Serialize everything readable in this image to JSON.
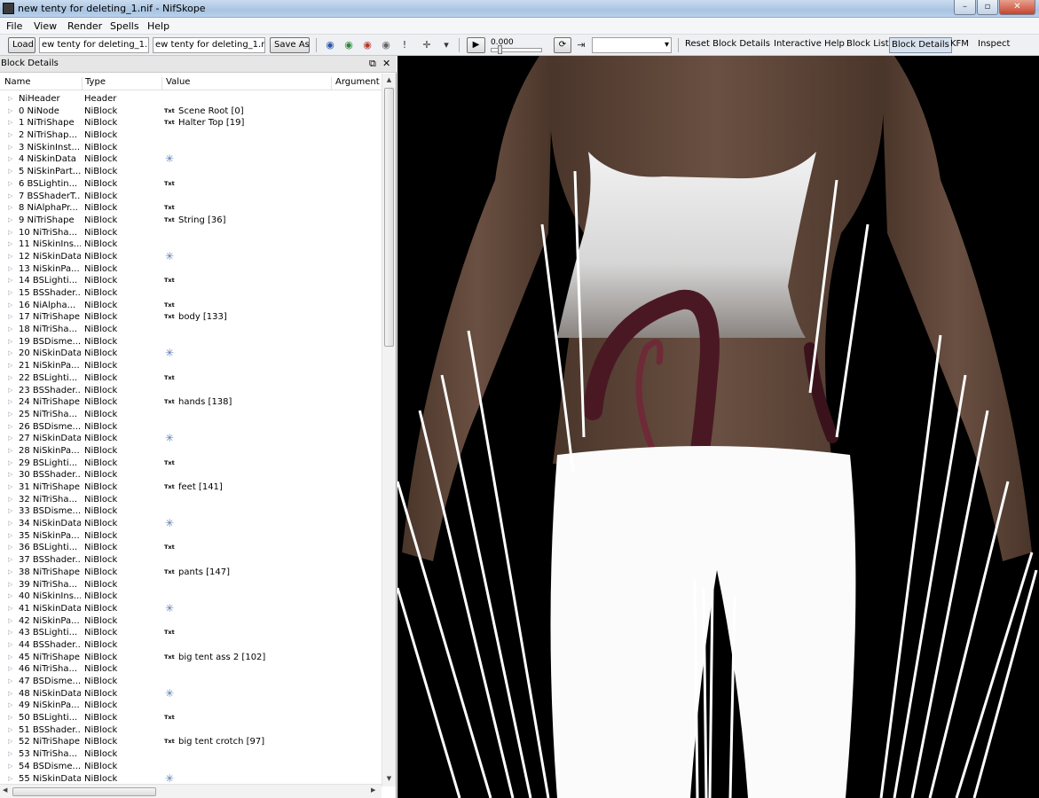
{
  "window": {
    "title": "new tenty for deleting_1.nif - NifSkope"
  },
  "menu": [
    "File",
    "View",
    "Render",
    "Spells",
    "Help"
  ],
  "toolbar": {
    "load_label": "Load",
    "file_in": "ew tenty for deleting_1.nif",
    "file_out": "ew tenty for deleting_1.nif",
    "save_as_label": "Save As",
    "time_value": "0.000",
    "reset_block_details": "Reset Block Details",
    "interactive_help": "Interactive Help",
    "block_list": "Block List",
    "block_details": "Block Details",
    "kfm": "KFM",
    "inspect": "Inspect"
  },
  "panel": {
    "title": "Block Details",
    "columns": [
      "Name",
      "Type",
      "Value",
      "Argument"
    ]
  },
  "rows": [
    {
      "name": "NiHeader",
      "type": "Header",
      "tag": "",
      "value": ""
    },
    {
      "name": "0 NiNode",
      "type": "NiBlock",
      "tag": "Txt",
      "value": "Scene Root [0]"
    },
    {
      "name": "1 NiTriShape",
      "type": "NiBlock",
      "tag": "Txt",
      "value": "Halter Top [19]"
    },
    {
      "name": "2 NiTriShap...",
      "type": "NiBlock",
      "tag": "",
      "value": ""
    },
    {
      "name": "3 NiSkinInst...",
      "type": "NiBlock",
      "tag": "",
      "value": ""
    },
    {
      "name": "4 NiSkinData",
      "type": "NiBlock",
      "tag": "star",
      "value": ""
    },
    {
      "name": "5 NiSkinPart...",
      "type": "NiBlock",
      "tag": "",
      "value": ""
    },
    {
      "name": "6 BSLightin...",
      "type": "NiBlock",
      "tag": "Txt",
      "value": ""
    },
    {
      "name": "7 BSShaderT...",
      "type": "NiBlock",
      "tag": "",
      "value": ""
    },
    {
      "name": "8 NiAlphaPr...",
      "type": "NiBlock",
      "tag": "Txt",
      "value": ""
    },
    {
      "name": "9 NiTriShape",
      "type": "NiBlock",
      "tag": "Txt",
      "value": "String [36]"
    },
    {
      "name": "10 NiTriSha...",
      "type": "NiBlock",
      "tag": "",
      "value": ""
    },
    {
      "name": "11 NiSkinIns...",
      "type": "NiBlock",
      "tag": "",
      "value": ""
    },
    {
      "name": "12 NiSkinData",
      "type": "NiBlock",
      "tag": "star",
      "value": ""
    },
    {
      "name": "13 NiSkinPa...",
      "type": "NiBlock",
      "tag": "",
      "value": ""
    },
    {
      "name": "14 BSLighti...",
      "type": "NiBlock",
      "tag": "Txt",
      "value": ""
    },
    {
      "name": "15 BSShader...",
      "type": "NiBlock",
      "tag": "",
      "value": ""
    },
    {
      "name": "16 NiAlpha...",
      "type": "NiBlock",
      "tag": "Txt",
      "value": ""
    },
    {
      "name": "17 NiTriShape",
      "type": "NiBlock",
      "tag": "Txt",
      "value": "body [133]"
    },
    {
      "name": "18 NiTriSha...",
      "type": "NiBlock",
      "tag": "",
      "value": ""
    },
    {
      "name": "19 BSDisme...",
      "type": "NiBlock",
      "tag": "",
      "value": ""
    },
    {
      "name": "20 NiSkinData",
      "type": "NiBlock",
      "tag": "star",
      "value": ""
    },
    {
      "name": "21 NiSkinPa...",
      "type": "NiBlock",
      "tag": "",
      "value": ""
    },
    {
      "name": "22 BSLighti...",
      "type": "NiBlock",
      "tag": "Txt",
      "value": ""
    },
    {
      "name": "23 BSShader...",
      "type": "NiBlock",
      "tag": "",
      "value": ""
    },
    {
      "name": "24 NiTriShape",
      "type": "NiBlock",
      "tag": "Txt",
      "value": "hands [138]"
    },
    {
      "name": "25 NiTriSha...",
      "type": "NiBlock",
      "tag": "",
      "value": ""
    },
    {
      "name": "26 BSDisme...",
      "type": "NiBlock",
      "tag": "",
      "value": ""
    },
    {
      "name": "27 NiSkinData",
      "type": "NiBlock",
      "tag": "star",
      "value": ""
    },
    {
      "name": "28 NiSkinPa...",
      "type": "NiBlock",
      "tag": "",
      "value": ""
    },
    {
      "name": "29 BSLighti...",
      "type": "NiBlock",
      "tag": "Txt",
      "value": ""
    },
    {
      "name": "30 BSShader...",
      "type": "NiBlock",
      "tag": "",
      "value": ""
    },
    {
      "name": "31 NiTriShape",
      "type": "NiBlock",
      "tag": "Txt",
      "value": "feet [141]"
    },
    {
      "name": "32 NiTriSha...",
      "type": "NiBlock",
      "tag": "",
      "value": ""
    },
    {
      "name": "33 BSDisme...",
      "type": "NiBlock",
      "tag": "",
      "value": ""
    },
    {
      "name": "34 NiSkinData",
      "type": "NiBlock",
      "tag": "star",
      "value": ""
    },
    {
      "name": "35 NiSkinPa...",
      "type": "NiBlock",
      "tag": "",
      "value": ""
    },
    {
      "name": "36 BSLighti...",
      "type": "NiBlock",
      "tag": "Txt",
      "value": ""
    },
    {
      "name": "37 BSShader...",
      "type": "NiBlock",
      "tag": "",
      "value": ""
    },
    {
      "name": "38 NiTriShape",
      "type": "NiBlock",
      "tag": "Txt",
      "value": "pants [147]"
    },
    {
      "name": "39 NiTriSha...",
      "type": "NiBlock",
      "tag": "",
      "value": ""
    },
    {
      "name": "40 NiSkinIns...",
      "type": "NiBlock",
      "tag": "",
      "value": ""
    },
    {
      "name": "41 NiSkinData",
      "type": "NiBlock",
      "tag": "star",
      "value": ""
    },
    {
      "name": "42 NiSkinPa...",
      "type": "NiBlock",
      "tag": "",
      "value": ""
    },
    {
      "name": "43 BSLighti...",
      "type": "NiBlock",
      "tag": "Txt",
      "value": ""
    },
    {
      "name": "44 BSShader...",
      "type": "NiBlock",
      "tag": "",
      "value": ""
    },
    {
      "name": "45 NiTriShape",
      "type": "NiBlock",
      "tag": "Txt",
      "value": "big tent ass 2 [102]"
    },
    {
      "name": "46 NiTriSha...",
      "type": "NiBlock",
      "tag": "",
      "value": ""
    },
    {
      "name": "47 BSDisme...",
      "type": "NiBlock",
      "tag": "",
      "value": ""
    },
    {
      "name": "48 NiSkinData",
      "type": "NiBlock",
      "tag": "star",
      "value": ""
    },
    {
      "name": "49 NiSkinPa...",
      "type": "NiBlock",
      "tag": "",
      "value": ""
    },
    {
      "name": "50 BSLighti...",
      "type": "NiBlock",
      "tag": "Txt",
      "value": ""
    },
    {
      "name": "51 BSShader...",
      "type": "NiBlock",
      "tag": "",
      "value": ""
    },
    {
      "name": "52 NiTriShape",
      "type": "NiBlock",
      "tag": "Txt",
      "value": "big tent crotch [97]"
    },
    {
      "name": "53 NiTriSha...",
      "type": "NiBlock",
      "tag": "",
      "value": ""
    },
    {
      "name": "54 BSDisme...",
      "type": "NiBlock",
      "tag": "",
      "value": ""
    },
    {
      "name": "55 NiSkinData",
      "type": "NiBlock",
      "tag": "star",
      "value": ""
    }
  ],
  "colors": {
    "viewport_bg": "#000000",
    "skin": "#5e4538",
    "top_fabric": "#e8e8e8",
    "pants": "#ffffff",
    "tentacle": "#5a1f2a"
  }
}
